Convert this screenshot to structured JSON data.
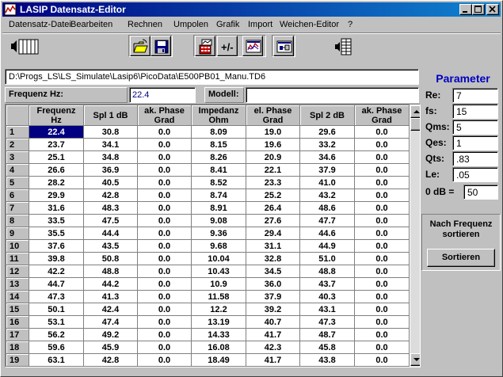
{
  "window": {
    "title": "LASIP  Datensatz-Editor"
  },
  "menu": [
    "Datensatz-Datei",
    "Bearbeiten",
    "Rechnen",
    "Umpolen",
    "Grafik",
    "Import",
    "Weichen-Editor",
    "?"
  ],
  "toolbar": {
    "buttons": [
      "speaker-icon",
      "open-folder-icon",
      "save-icon",
      "calculator-icon",
      "polarity-icon",
      "chart-icon",
      "crossover-icon",
      "table-icon"
    ]
  },
  "path": {
    "value": "D:\\Progs_LS\\LS_Simulate\\Lasip6\\PicoData\\E500PB01_Manu.TD6"
  },
  "frequency": {
    "label": "Frequenz Hz:",
    "value": "22.4"
  },
  "modell": {
    "label": "Modell:",
    "value": ""
  },
  "table": {
    "headers": [
      [
        "Frequenz",
        "Hz"
      ],
      [
        "Spl 1 dB",
        ""
      ],
      [
        "ak. Phase",
        "Grad"
      ],
      [
        "Impedanz",
        "Ohm"
      ],
      [
        "el. Phase",
        "Grad"
      ],
      [
        "Spl 2 dB",
        ""
      ],
      [
        "ak. Phase",
        "Grad"
      ]
    ],
    "rows": [
      [
        "1",
        "22.4",
        "30.8",
        "0.0",
        "8.09",
        "19.0",
        "29.6",
        "0.0"
      ],
      [
        "2",
        "23.7",
        "34.1",
        "0.0",
        "8.15",
        "19.6",
        "33.2",
        "0.0"
      ],
      [
        "3",
        "25.1",
        "34.8",
        "0.0",
        "8.26",
        "20.9",
        "34.6",
        "0.0"
      ],
      [
        "4",
        "26.6",
        "36.9",
        "0.0",
        "8.41",
        "22.1",
        "37.9",
        "0.0"
      ],
      [
        "5",
        "28.2",
        "40.5",
        "0.0",
        "8.52",
        "23.3",
        "41.0",
        "0.0"
      ],
      [
        "6",
        "29.9",
        "42.8",
        "0.0",
        "8.74",
        "25.2",
        "43.2",
        "0.0"
      ],
      [
        "7",
        "31.6",
        "48.3",
        "0.0",
        "8.91",
        "26.4",
        "48.6",
        "0.0"
      ],
      [
        "8",
        "33.5",
        "47.5",
        "0.0",
        "9.08",
        "27.6",
        "47.7",
        "0.0"
      ],
      [
        "9",
        "35.5",
        "44.4",
        "0.0",
        "9.36",
        "29.4",
        "44.6",
        "0.0"
      ],
      [
        "10",
        "37.6",
        "43.5",
        "0.0",
        "9.68",
        "31.1",
        "44.9",
        "0.0"
      ],
      [
        "11",
        "39.8",
        "50.8",
        "0.0",
        "10.04",
        "32.8",
        "51.0",
        "0.0"
      ],
      [
        "12",
        "42.2",
        "48.8",
        "0.0",
        "10.43",
        "34.5",
        "48.8",
        "0.0"
      ],
      [
        "13",
        "44.7",
        "44.2",
        "0.0",
        "10.9",
        "36.0",
        "43.7",
        "0.0"
      ],
      [
        "14",
        "47.3",
        "41.3",
        "0.0",
        "11.58",
        "37.9",
        "40.3",
        "0.0"
      ],
      [
        "15",
        "50.1",
        "42.4",
        "0.0",
        "12.2",
        "39.2",
        "43.1",
        "0.0"
      ],
      [
        "16",
        "53.1",
        "47.4",
        "0.0",
        "13.19",
        "40.7",
        "47.3",
        "0.0"
      ],
      [
        "17",
        "56.2",
        "49.2",
        "0.0",
        "14.33",
        "41.7",
        "48.7",
        "0.0"
      ],
      [
        "18",
        "59.6",
        "45.9",
        "0.0",
        "16.08",
        "42.3",
        "45.8",
        "0.0"
      ],
      [
        "19",
        "63.1",
        "42.8",
        "0.0",
        "18.49",
        "41.7",
        "43.8",
        "0.0"
      ]
    ]
  },
  "parameter": {
    "title": "Parameter",
    "fields": [
      {
        "label": "Re:",
        "value": "7"
      },
      {
        "label": "fs:",
        "value": "15"
      },
      {
        "label": "Qms:",
        "value": "5"
      },
      {
        "label": "Qes:",
        "value": "1"
      },
      {
        "label": "Qts:",
        "value": ".83"
      },
      {
        "label": "Le:",
        "value": ".05"
      },
      {
        "label": "0 dB =",
        "value": "50"
      }
    ]
  },
  "sort": {
    "title_line1": "Nach Frequenz",
    "title_line2": "sortieren",
    "button": "Sortieren"
  },
  "colors": {
    "titlebar": "#000080",
    "selection": "#000080",
    "param_title": "#0000c0",
    "face": "#c0c0c0"
  }
}
